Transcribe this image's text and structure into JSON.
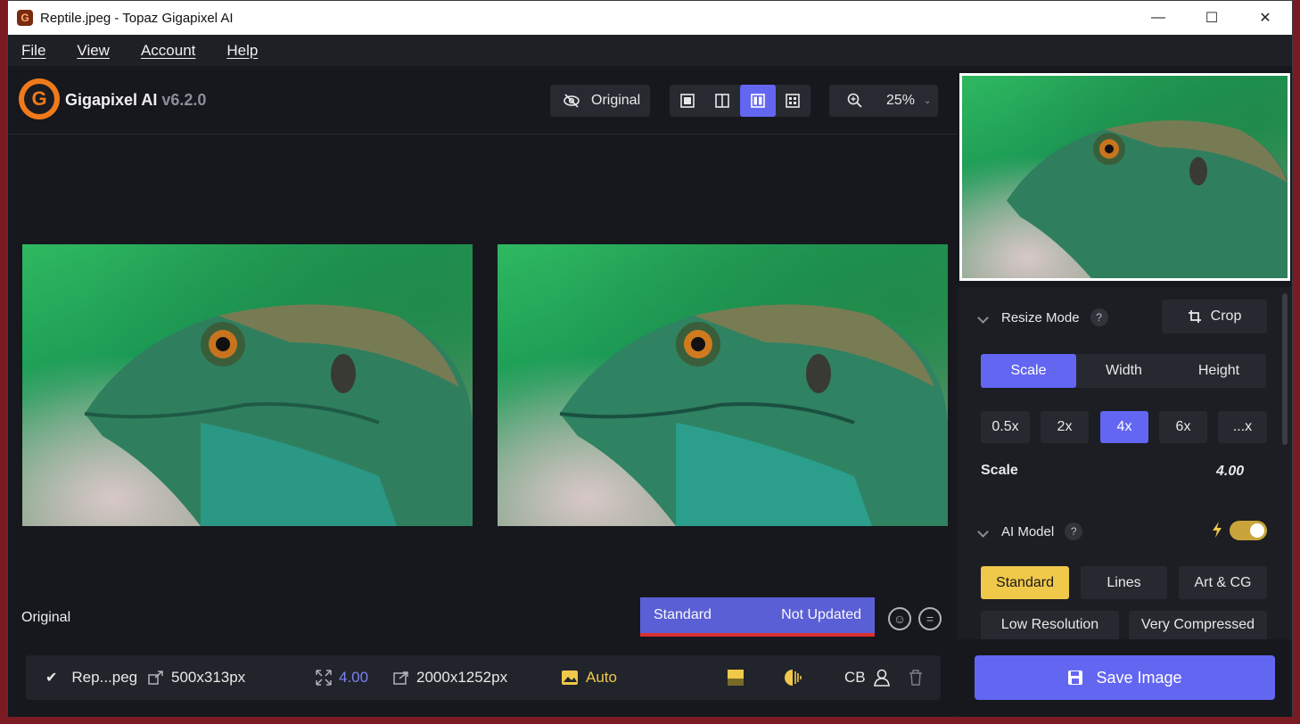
{
  "titlebar": {
    "title": "Reptile.jpeg - Topaz Gigapixel AI",
    "icon": "G",
    "minimize": "—",
    "maximize": "☐",
    "close": "✕"
  },
  "menu": {
    "file": "File",
    "view": "View",
    "account": "Account",
    "help": "Help"
  },
  "header": {
    "brand": "Gigapixel AI",
    "version": "v6.2.0",
    "logo_letter": "G",
    "original_button": "Original",
    "zoom": "25%"
  },
  "canvas": {
    "original_label": "Original",
    "model_name": "Standard",
    "update_status": "Not Updated"
  },
  "filebar": {
    "filename": "Rep...peg",
    "source_size": "500x313px",
    "scale": "4.00",
    "output_size": "2000x1252px",
    "auto": "Auto",
    "cb": "CB"
  },
  "resize": {
    "title": "Resize Mode",
    "help": "?",
    "crop": "Crop",
    "modes": [
      "Scale",
      "Width",
      "Height"
    ],
    "active_mode": "Scale",
    "presets": [
      "0.5x",
      "2x",
      "4x",
      "6x",
      "...x"
    ],
    "active_preset": "4x",
    "scale_label": "Scale",
    "scale_value": "4.00"
  },
  "ai_model": {
    "title": "AI Model",
    "help": "?",
    "toggle_on": true,
    "models_row1": [
      "Standard",
      "Lines",
      "Art & CG"
    ],
    "models_row2": [
      "Low Resolution",
      "Very Compressed"
    ],
    "active_model": "Standard"
  },
  "save_button": "Save Image",
  "colors": {
    "accent": "#6366f1",
    "yellow": "#f0c84a",
    "warning": "#d9302f",
    "bg": "#16181d"
  }
}
